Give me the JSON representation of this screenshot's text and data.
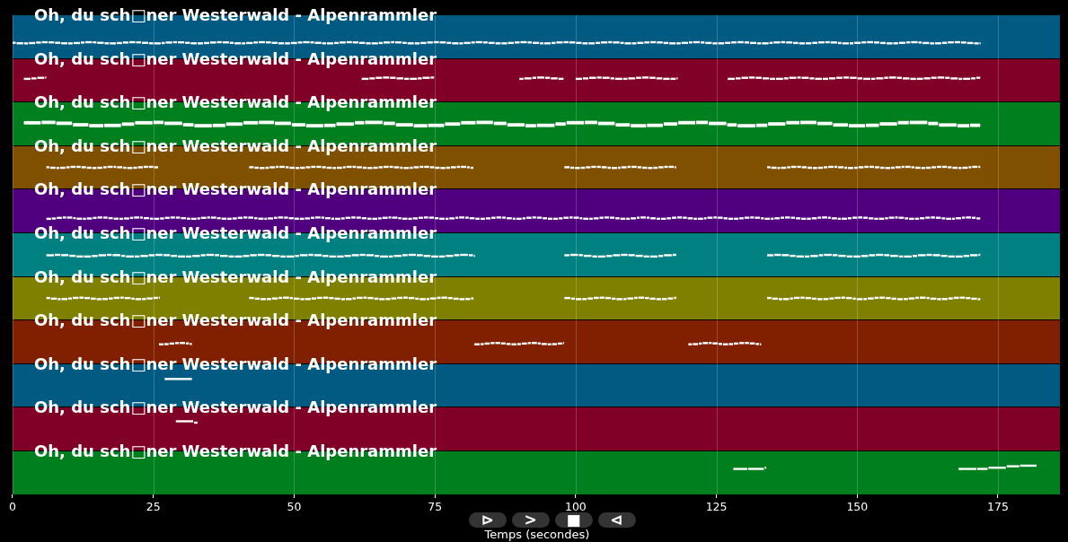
{
  "tracks": [
    {
      "title": "Oh, du sch□ner Westerwald - Alpenrammler",
      "color": "#005a82"
    },
    {
      "title": "Oh, du sch□ner Westerwald - Alpenrammler",
      "color": "#800028"
    },
    {
      "title": "Oh, du sch□ner Westerwald - Alpenrammler",
      "color": "#007f1f"
    },
    {
      "title": "Oh, du sch□ner Westerwald - Alpenrammler",
      "color": "#7f5000"
    },
    {
      "title": "Oh, du sch□ner Westerwald - Alpenrammler",
      "color": "#50007f"
    },
    {
      "title": "Oh, du sch□ner Westerwald - Alpenrammler",
      "color": "#008080"
    },
    {
      "title": "Oh, du sch□ner Westerwald - Alpenrammler",
      "color": "#808000"
    },
    {
      "title": "Oh, du sch□ner Westerwald - Alpenrammler",
      "color": "#802000"
    },
    {
      "title": "Oh, du sch□ner Westerwald - Alpenrammler",
      "color": "#005a82"
    },
    {
      "title": "Oh, du sch□ner Westerwald - Alpenrammler",
      "color": "#800028"
    },
    {
      "title": "Oh, du sch□ner Westerwald - Alpenrammler",
      "color": "#007f1f"
    }
  ],
  "axis": {
    "ticks": [
      "0",
      "25",
      "50",
      "75",
      "100",
      "125",
      "150",
      "175"
    ],
    "label": "Temps (secondes)"
  },
  "controls": [
    "⊳",
    ">",
    "■",
    "⊲"
  ]
}
